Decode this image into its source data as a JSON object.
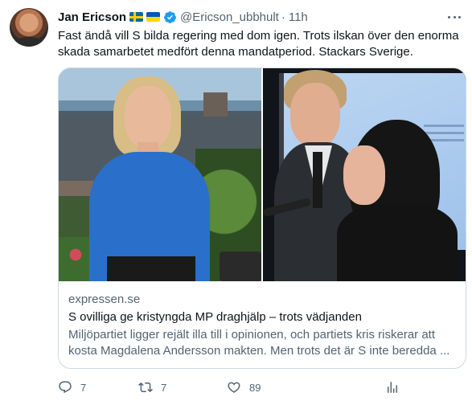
{
  "author": {
    "display_name": "Jan Ericson",
    "flags": [
      "sweden-flag",
      "ukraine-flag"
    ],
    "verified": true,
    "handle": "@Ericson_ubbhult",
    "separator": "·",
    "time": "11h"
  },
  "tweet": {
    "text": "Fast ändå vill S bilda regering med dom igen. Trots ilskan över den enorma skada samarbetet medfört denna mandatperiod. Stackars Sverige."
  },
  "card": {
    "domain": "expressen.se",
    "title": "S ovilliga ge kristyngda MP draghjälp – trots vädjanden",
    "description": "Miljöpartiet ligger rejält illa till i opinionen, och partiets kris riskerar att kosta Magdalena Andersson makten. Men trots det är S inte beredda ..."
  },
  "actions": {
    "replies": "7",
    "retweets": "7",
    "likes": "89"
  },
  "colors": {
    "text": "#0f1419",
    "secondary": "#536471",
    "verified_blue": "#1d9bf0",
    "border": "#cfd9de"
  },
  "icons": [
    "more-icon",
    "verified-icon",
    "reply-icon",
    "retweet-icon",
    "like-icon",
    "analytics-icon"
  ]
}
